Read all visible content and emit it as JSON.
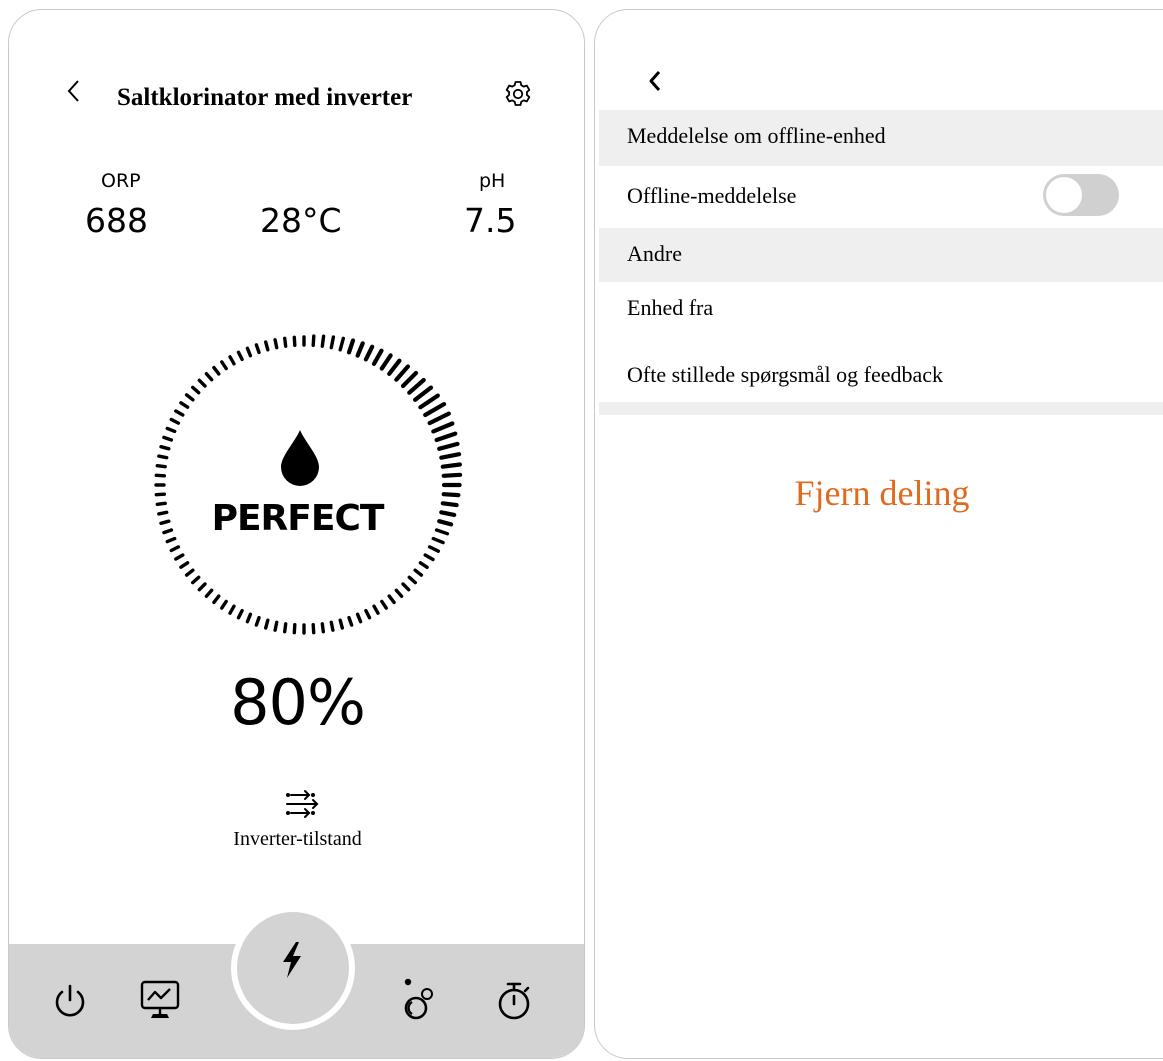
{
  "left_screen": {
    "header": {
      "title": "Saltklorinator med inverter",
      "back_icon": "chevron-left-icon",
      "settings_icon": "gear-icon"
    },
    "stats": {
      "orp": {
        "label": "ORP",
        "value": "688"
      },
      "temperature": {
        "value": "28°C"
      },
      "ph": {
        "label": "pH",
        "value": "7.5"
      }
    },
    "gauge": {
      "status": "PERFECT",
      "center_icon": "water-drop-icon",
      "percent_text": "80%",
      "level": 0.8
    },
    "mode": {
      "icon": "sliders-icon",
      "label": "Inverter-tilstand"
    },
    "bottom_nav": {
      "items": [
        "power-icon",
        "monitor-chart-icon",
        "lightning-bolt-icon",
        "bubbles-icon",
        "timer-icon"
      ]
    }
  },
  "right_screen": {
    "back_icon": "chevron-left-icon",
    "sections": {
      "offline_header": "Meddelelse om offline-enhed",
      "offline_toggle_label": "Offline-meddelelse",
      "offline_toggle_on": false,
      "others_header": "Andre",
      "device_off": "Enhed fra",
      "faq": "Ofte stillede spørgsmål og feedback"
    },
    "remove_share": "Fjern deling"
  },
  "colors": {
    "accent_orange": "#e06a1e",
    "bottom_bar": "#d3d3d3",
    "section_bg": "#efefef",
    "toggle_off": "#d0d0d0"
  }
}
